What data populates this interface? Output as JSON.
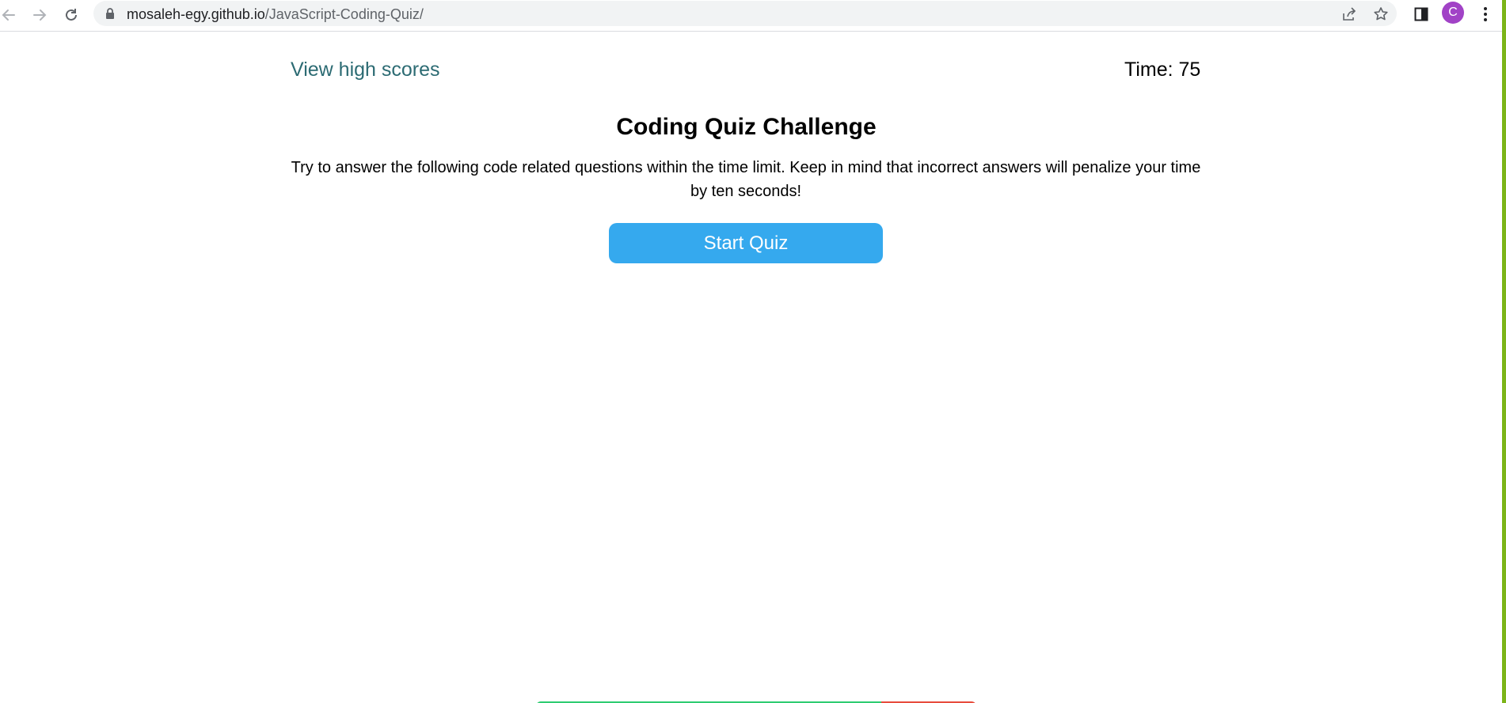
{
  "browser": {
    "url_host": "mosaleh-egy.github.io",
    "url_path": "/JavaScript-Coding-Quiz/",
    "profile_initial": "C"
  },
  "header": {
    "highscores_link": "View high scores",
    "timer_label": "Time: 75"
  },
  "intro": {
    "title": "Coding Quiz Challenge",
    "description": "Try to answer the following code related questions within the time limit. Keep in mind that incorrect answers will penalize your time by ten seconds!",
    "start_button": "Start Quiz"
  },
  "colors": {
    "link": "#2c6b73",
    "button": "#35a9ee",
    "correct_bar": "#2ecc71",
    "wrong_bar": "#e74c3c",
    "avatar": "#a142c6"
  }
}
